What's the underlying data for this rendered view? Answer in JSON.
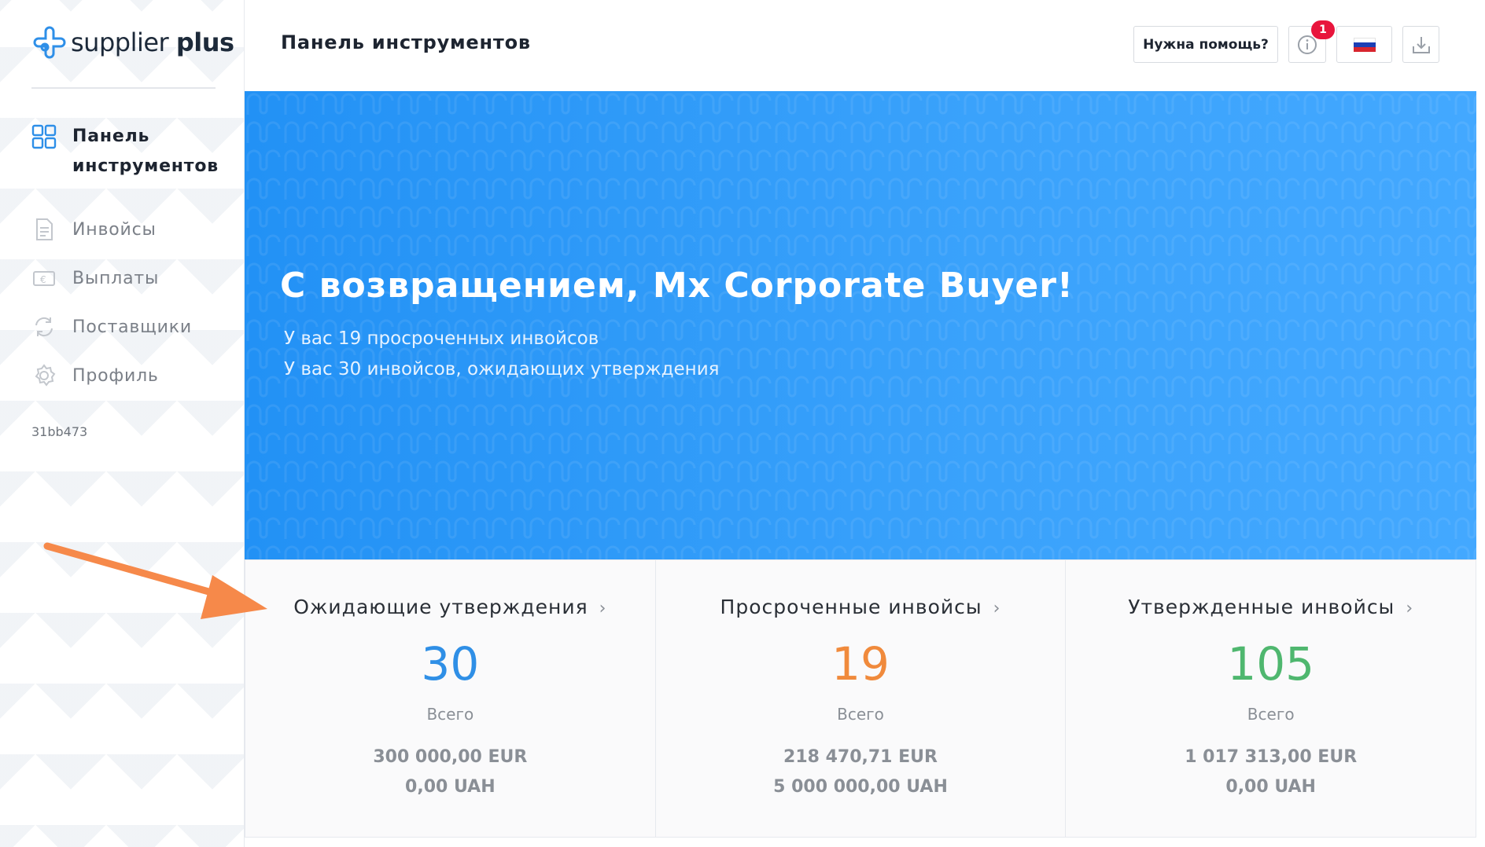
{
  "brand": {
    "logo_regular": "supplier",
    "logo_bold": "plus"
  },
  "sidebar": {
    "items": [
      {
        "label": "Панель инструментов",
        "icon": "dashboard-icon",
        "active": true
      },
      {
        "label": "Инвойсы",
        "icon": "invoice-icon"
      },
      {
        "label": "Выплаты",
        "icon": "payment-icon"
      },
      {
        "label": "Поставщики",
        "icon": "suppliers-icon"
      },
      {
        "label": "Профиль",
        "icon": "gear-icon"
      }
    ],
    "version": "31bb473"
  },
  "header": {
    "title": "Панель инструментов",
    "help_label": "Нужна помощь?",
    "notifications_count": "1",
    "language_flag": "ru-flag-icon"
  },
  "hero": {
    "title": "С возвращением, Mx Corporate Buyer!",
    "line1": "У вас 19 просроченных инвойсов",
    "line2": "У вас 30 инвойсов, ожидающих утверждения"
  },
  "stats": [
    {
      "title": "Ожидающие утверждения",
      "value": "30",
      "label": "Всего",
      "amount_eur": "300 000,00 EUR",
      "amount_uah": "0,00 UAH",
      "color": "#2f8fe6"
    },
    {
      "title": "Просроченные инвойсы",
      "value": "19",
      "label": "Всего",
      "amount_eur": "218 470,71 EUR",
      "amount_uah": "5 000 000,00 UAH",
      "color": "#f08a3c"
    },
    {
      "title": "Утвержденные инвойсы",
      "value": "105",
      "label": "Всего",
      "amount_eur": "1 017 313,00 EUR",
      "amount_uah": "0,00 UAH",
      "color": "#4fb76f"
    }
  ],
  "colors": {
    "accent": "#2291f5",
    "badge": "#e8153c",
    "annotation_arrow": "#f6894a"
  }
}
